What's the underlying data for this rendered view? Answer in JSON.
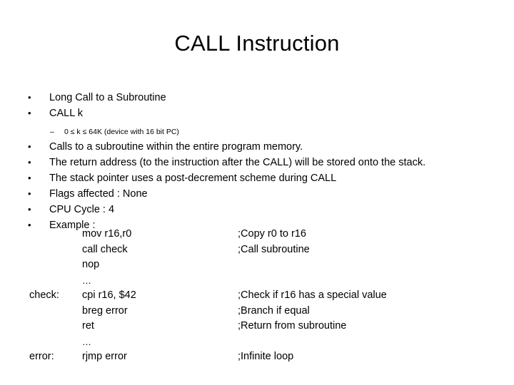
{
  "slide": {
    "title": "CALL Instruction",
    "bullet_marker": "•",
    "sub_marker": "–",
    "bullets": [
      {
        "text": "Long Call to a Subroutine"
      },
      {
        "text": "CALL k"
      },
      {
        "text": "Calls to a subroutine within the entire program memory."
      },
      {
        "text": "The return address (to the instruction after the CALL) will be stored onto the stack."
      },
      {
        "text": "The stack pointer uses a post-decrement scheme during CALL"
      },
      {
        "text": "Flags affected : None"
      },
      {
        "text": "CPU Cycle : 4"
      },
      {
        "text": "Example :"
      }
    ],
    "sub_bullet": {
      "text": "0 ≤ k ≤ 64K (device with 16 bit PC)"
    },
    "code_lines": [
      {
        "label": "",
        "instr": "mov r16,r0",
        "comment": ";Copy r0 to r16"
      },
      {
        "label": "",
        "instr": "call check",
        "comment": ";Call subroutine"
      },
      {
        "label": "",
        "instr": "nop",
        "comment": ""
      },
      {
        "label": "",
        "instr": "…",
        "comment": ""
      },
      {
        "label": "check:",
        "instr": "cpi r16, $42",
        "comment": ";Check if r16 has a special value"
      },
      {
        "label": "",
        "instr": "breg error",
        "comment": ";Branch if equal"
      },
      {
        "label": "",
        "instr": "ret",
        "comment": ";Return from subroutine"
      },
      {
        "label": "",
        "instr": "…",
        "comment": ""
      },
      {
        "label": "error:",
        "instr": "rjmp error",
        "comment": ";Infinite loop"
      }
    ]
  },
  "colors": {
    "background": "#ffffff",
    "text": "#000000"
  }
}
